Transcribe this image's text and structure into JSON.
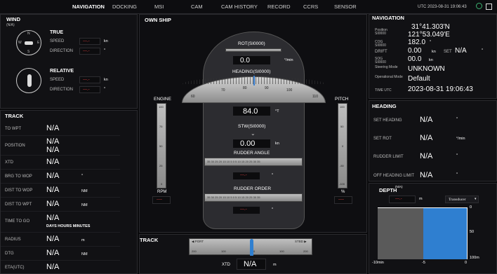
{
  "topbar": {
    "tabs": [
      "NAVIGATION",
      "DOCKING",
      "MSI",
      "CAM",
      "CAM HISTORY",
      "RECORD",
      "CCRS",
      "SENSOR"
    ],
    "datetime": "UTC 2023-08-31 19:06:43"
  },
  "wind": {
    "title": "WIND",
    "subtitle": "(N/A)",
    "true": {
      "title": "TRUE",
      "speed_label": "SPEED",
      "speed_value": "---.-",
      "speed_unit": "kn",
      "dir_label": "DIRECTION",
      "dir_value": "---.-",
      "dir_unit": "°"
    },
    "relative": {
      "title": "RELATIVE",
      "speed_label": "SPEED",
      "speed_value": "---.-",
      "speed_unit": "kn",
      "dir_label": "DIRECTION",
      "dir_value": "---.-",
      "dir_unit": "°"
    },
    "compass": {
      "n": "N",
      "s": "S",
      "e": "E",
      "w": "W"
    }
  },
  "track_left": {
    "title": "TRACK",
    "rows": [
      {
        "label": "TO WPT",
        "value": "N/A",
        "unit": ""
      },
      {
        "label": "POSITION",
        "value": "N/A",
        "value2": "N/A",
        "unit": ""
      },
      {
        "label": "XTD",
        "value": "N/A",
        "unit": ""
      },
      {
        "label": "BRG TO WOP",
        "value": "N/A",
        "unit": "°"
      },
      {
        "label": "DIST TO WOP",
        "value": "N/A",
        "unit": "NM"
      },
      {
        "label": "DIST TO WPT",
        "value": "N/A",
        "unit": "NM"
      },
      {
        "label": "TIME TO GO",
        "value": "N/A",
        "unit": "DAYS  HOURS  MINUTES"
      },
      {
        "label": "RADIUS",
        "value": "N/A",
        "unit": "m"
      },
      {
        "label": "DTG",
        "value": "N/A",
        "unit": "NM"
      },
      {
        "label": "ETA(UTC)",
        "value": "N/A",
        "unit": ""
      }
    ]
  },
  "own_ship": {
    "title": "OWN SHIP",
    "rot_label": "ROT(SI0000)",
    "rot_value": "0.0",
    "rot_unit": "°/min",
    "heading_label": "HEADING(SI0000)",
    "heading_ticks": [
      "60",
      "70",
      "80",
      "90",
      "100",
      "110"
    ],
    "heading_value": "84.0",
    "heading_unit": "°T",
    "stw_label": "STW(SI0000)",
    "stw_value": "0.00",
    "stw_unit": "kn",
    "rudder_angle_label": "RUDDER ANGLE",
    "rudder_angle_value": "---.-",
    "rudder_unit": "°",
    "rudder_order_label": "RUDDER ORDER",
    "rudder_order_value": "---.-",
    "rudder_scale": "35 30 25 20 15 10 5  0  5 10 15 20 25 30 35",
    "engine_label": "ENGINE",
    "engine_ticks": [
      "100",
      "75",
      "50",
      "25",
      "0"
    ],
    "rpm_label": "RPM",
    "rpm_value": "----",
    "pitch_label": "PITCH",
    "pitch_ticks": [
      "100",
      "50",
      "0",
      "-50",
      "-100"
    ],
    "pitch_unit": "%",
    "pitch_value": "----"
  },
  "track_bottom": {
    "title": "TRACK",
    "port": "◀ PORT",
    "stbd": "STBD ▶",
    "ticks": [
      "200",
      "100",
      "0",
      "100",
      "200"
    ],
    "xtd_label": "XTD",
    "xtd_value": "N/A",
    "xtd_unit": "m"
  },
  "navigation": {
    "title": "NAVIGATION",
    "position_label": "Position",
    "position_src": "SI0000",
    "lat": "31°41.303'N",
    "lon": "121°53.049'E",
    "cog_label": "COG",
    "cog_src": "SI0000",
    "cog_value": "182.0",
    "cog_unit": "°",
    "drift_label": "DRIFT",
    "drift_value": "0.00",
    "drift_unit": "kn",
    "set_label": "SET",
    "set_value": "N/A",
    "set_unit": "°",
    "sog_label": "SOG",
    "sog_src": "SI0000",
    "sog_value": "00.0",
    "sog_unit": "kn",
    "steering_label": "Steering Mode",
    "steering_value": "UNKNOWN",
    "operational_label": "Operational Mode",
    "operational_value": "Default",
    "time_label": "TIME UTC",
    "time_value": "2023-08-31 19:06:43"
  },
  "heading": {
    "title": "HEADING",
    "rows": [
      {
        "label": "SET HEADING",
        "value": "N/A",
        "unit": "°"
      },
      {
        "label": "SET ROT",
        "value": "N/A",
        "unit": "°/min"
      },
      {
        "label": "RUDDER LIMIT",
        "value": "N/A",
        "unit": "°"
      },
      {
        "label": "OFF HEADING LIMIT",
        "value": "N/A",
        "unit": "°"
      }
    ]
  },
  "depth": {
    "title": "DEPTH",
    "sup": "(N/A)",
    "value": "---.-",
    "unit": "m",
    "source": "Transducer",
    "y_ticks": [
      "0",
      "50",
      "100m"
    ],
    "x_ticks": [
      "-10min",
      "-5",
      "0"
    ]
  },
  "colors": {
    "accent": "#2f7fd0",
    "red": "#e04040"
  }
}
